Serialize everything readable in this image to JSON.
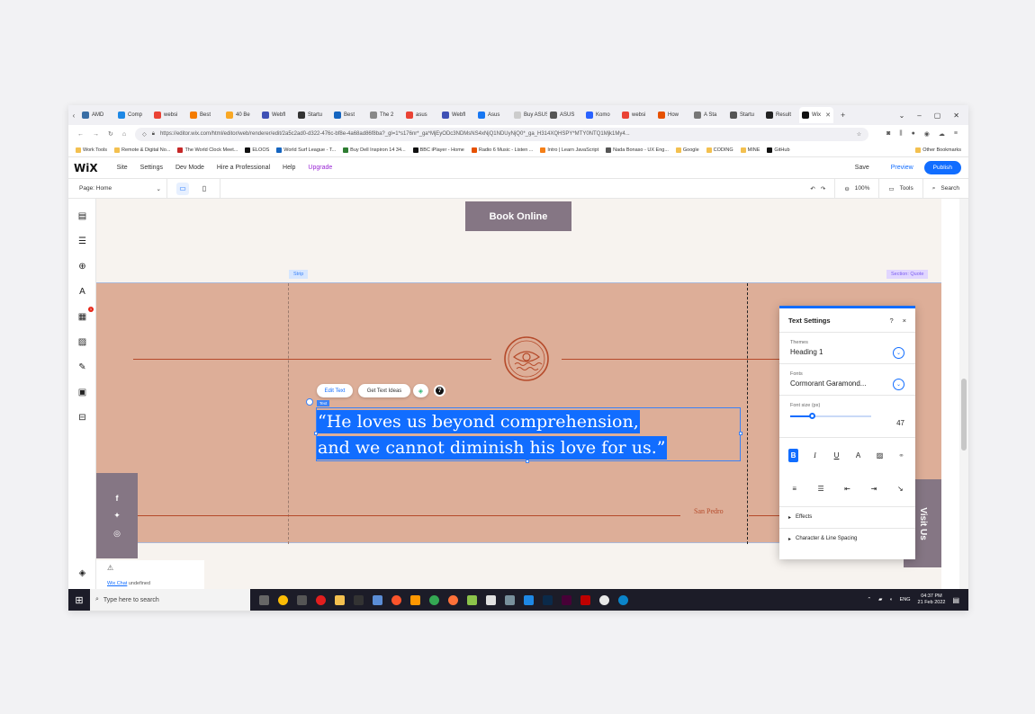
{
  "browser": {
    "tabs": [
      {
        "label": "AMD",
        "color": "#3a6ea5"
      },
      {
        "label": "Comp",
        "color": "#1e88e5"
      },
      {
        "label": "websi",
        "color": "#ea4335"
      },
      {
        "label": "Best",
        "color": "#f57c00"
      },
      {
        "label": "40 Be",
        "color": "#f9a825"
      },
      {
        "label": "Webfl",
        "color": "#3f51b5"
      },
      {
        "label": "Startu",
        "color": "#333333"
      },
      {
        "label": "Best",
        "color": "#1565c0"
      },
      {
        "label": "The 2",
        "color": "#888888"
      },
      {
        "label": "asus",
        "color": "#ea4335"
      },
      {
        "label": "Webfl",
        "color": "#3f51b5"
      },
      {
        "label": "Asus",
        "color": "#1877f2"
      },
      {
        "label": "Buy ASUS",
        "color": "#cccccc"
      },
      {
        "label": "ASUS",
        "color": "#555555"
      },
      {
        "label": "Komo",
        "color": "#2962ff"
      },
      {
        "label": "websi",
        "color": "#ea4335"
      },
      {
        "label": "How",
        "color": "#e65100"
      },
      {
        "label": "A Sta",
        "color": "#777777"
      },
      {
        "label": "Startu",
        "color": "#555555"
      },
      {
        "label": "Result",
        "color": "#222222"
      }
    ],
    "active_tab": {
      "label": "Wix",
      "color": "#111111"
    },
    "new_tab": "+",
    "url": "https://editor.wix.com/html/editor/web/renderer/edit/2a5c2ad0-d322-476c-bf8e-4a68ad86f8ba?_gl=1*s176nr*_ga*MjEyODc3NDMsNS4xNjQ1NDUyNjQ0*_ga_H314XQHSPY*MTY0NTQ1Mjk1My4...",
    "bookmarks": [
      {
        "label": "Work Tools",
        "color": "#f3c04f"
      },
      {
        "label": "Remote & Digital No...",
        "color": "#f3c04f"
      },
      {
        "label": "The World Clock Meet...",
        "color": "#c62828"
      },
      {
        "label": "ELOOS",
        "color": "#111111"
      },
      {
        "label": "World Surf League - T...",
        "color": "#1565c0"
      },
      {
        "label": "Buy Dell Inspiron 14 34...",
        "color": "#2e7d32"
      },
      {
        "label": "BBC iPlayer - Home",
        "color": "#111111"
      },
      {
        "label": "Radio 6 Music - Listen ...",
        "color": "#e65100"
      },
      {
        "label": "Intro | Learn JavaScript",
        "color": "#f57f17"
      },
      {
        "label": "Nada Bonaso - UX Eng...",
        "color": "#555555"
      },
      {
        "label": "Google",
        "color": "#f3c04f"
      },
      {
        "label": "CODING",
        "color": "#f3c04f"
      },
      {
        "label": "MINE",
        "color": "#f3c04f"
      },
      {
        "label": "GitHub",
        "color": "#111111"
      }
    ],
    "other_bookmarks": "Other Bookmarks"
  },
  "wix": {
    "logo": "WiX",
    "menu": [
      "Site",
      "Settings",
      "Dev Mode",
      "Hire a Professional",
      "Help"
    ],
    "upgrade": "Upgrade",
    "save": "Save",
    "preview": "Preview",
    "publish": "Publish",
    "page_select": "Page: Home",
    "zoom": "100%",
    "tools": "Tools",
    "search": "Search"
  },
  "canvas": {
    "book_online": "Book Online",
    "strip_label": "Strip",
    "section_label": "Section: Quote",
    "edit_text": "Edit Text",
    "text_ideas": "Get Text Ideas",
    "help": "?",
    "text_tag": "Text",
    "quote_line1": "“He loves us beyond comprehension,",
    "quote_line2": "and we cannot diminish his love for us.”",
    "location": "San Pedro",
    "visit_us": "Visit Us",
    "chat_label": "Wix Chat",
    "chat_status": "undefined",
    "colors": {
      "section_bg": "#ddae98",
      "accent": "#b54a2a",
      "button_bg": "#857684",
      "selection": "#116dff"
    }
  },
  "text_settings": {
    "title": "Text Settings",
    "help": "?",
    "close": "×",
    "themes_label": "Themes",
    "theme_value": "Heading 1",
    "fonts_label": "Fonts",
    "font_value": "Cormorant Garamond...",
    "font_size_label": "Font size (px)",
    "font_size": "47",
    "font_size_level": 0.27,
    "effects": "Effects",
    "spacing": "Character & Line Spacing"
  },
  "taskbar": {
    "search_placeholder": "Type here to search",
    "lang": "ENG",
    "time": "04:37 PM",
    "date": "21 Feb 2022"
  }
}
